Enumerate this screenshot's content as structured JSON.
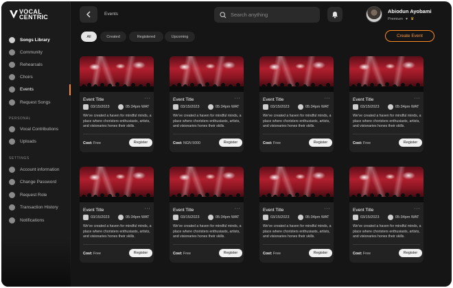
{
  "brand": {
    "line1": "VOCAL",
    "line2": "CENTRIC"
  },
  "sidebar": {
    "main": [
      {
        "label": "Songs Library",
        "icon": "music-icon"
      },
      {
        "label": "Community",
        "icon": "community-icon"
      },
      {
        "label": "Rehearsals",
        "icon": "rehearsal-icon"
      },
      {
        "label": "Choirs",
        "icon": "choir-icon"
      },
      {
        "label": "Events",
        "icon": "events-icon"
      },
      {
        "label": "Request Songs",
        "icon": "request-icon"
      }
    ],
    "personal_title": "PERSONAL",
    "personal": [
      {
        "label": "Vocal Contributions",
        "icon": "mic-icon"
      },
      {
        "label": "Uploads",
        "icon": "upload-icon"
      }
    ],
    "settings_title": "SETTINGS",
    "settings": [
      {
        "label": "Account information",
        "icon": "user-icon"
      },
      {
        "label": "Change Password",
        "icon": "lock-icon"
      },
      {
        "label": "Request Role",
        "icon": "role-icon"
      },
      {
        "label": "Transaction History",
        "icon": "history-icon"
      },
      {
        "label": "Notifications",
        "icon": "bell-icon"
      }
    ]
  },
  "header": {
    "page": "Events",
    "search_placeholder": "Search anything",
    "user_name": "Abiodun Ayobami",
    "user_tier": "Premium"
  },
  "filters": [
    "All",
    "Created",
    "Registered",
    "Upcoming"
  ],
  "create_label": "Create Event",
  "events": [
    {
      "title": "Event Title",
      "date": "03/15/2023",
      "time": "05:34pm WAT",
      "desc": "We've created a haven for mindful minds, a place where choristers  enthusiasts, artists, and visionaries hones their skills.",
      "cost_label": "Cost:",
      "cost": "Free",
      "register": "Register"
    },
    {
      "title": "Event Title",
      "date": "03/15/2023",
      "time": "05:34pm WAT",
      "desc": "We've created a haven for mindful minds, a place where choristers  enthusiasts, artists, and visionaries hones their skills.",
      "cost_label": "Cost:",
      "cost": "NGN 5000",
      "register": "Register"
    },
    {
      "title": "Event Title",
      "date": "03/15/2023",
      "time": "05:34pm WAT",
      "desc": "We've created a haven for mindful minds, a place where choristers  enthusiasts, artists, and visionaries hones their skills.",
      "cost_label": "Cost:",
      "cost": "Free",
      "register": "Register"
    },
    {
      "title": "Event Title",
      "date": "03/15/2023",
      "time": "05:34pm WAT",
      "desc": "We've created a haven for mindful minds, a place where choristers  enthusiasts, artists, and visionaries hones their skills.",
      "cost_label": "Cost:",
      "cost": "Free",
      "register": "Register"
    },
    {
      "title": "Event Title",
      "date": "03/15/2023",
      "time": "05:34pm WAT",
      "desc": "We've created a haven for mindful minds, a place where choristers  enthusiasts, artists, and visionaries hones their skills.",
      "cost_label": "Cost:",
      "cost": "Free",
      "register": "Register"
    },
    {
      "title": "Event Title",
      "date": "03/15/2023",
      "time": "05:34pm WAT",
      "desc": "We've created a haven for mindful minds, a place where choristers  enthusiasts, artists, and visionaries hones their skills.",
      "cost_label": "Cost:",
      "cost": "Free",
      "register": "Register"
    },
    {
      "title": "Event Title",
      "date": "03/15/2023",
      "time": "05:34pm WAT",
      "desc": "We've created a haven for mindful minds, a place where choristers  enthusiasts, artists, and visionaries hones their skills.",
      "cost_label": "Cost:",
      "cost": "Free",
      "register": "Register"
    },
    {
      "title": "Event Title",
      "date": "03/15/2023",
      "time": "05:34pm WAT",
      "desc": "We've created a haven for mindful minds, a place where choristers  enthusiasts, artists, and visionaries hones their skills.",
      "cost_label": "Cost:",
      "cost": "Free",
      "register": "Register"
    }
  ],
  "colors": {
    "accent": "#ff8a1f",
    "background": "#151515",
    "sidebar": "#1b1b1b",
    "card": "#222222"
  }
}
